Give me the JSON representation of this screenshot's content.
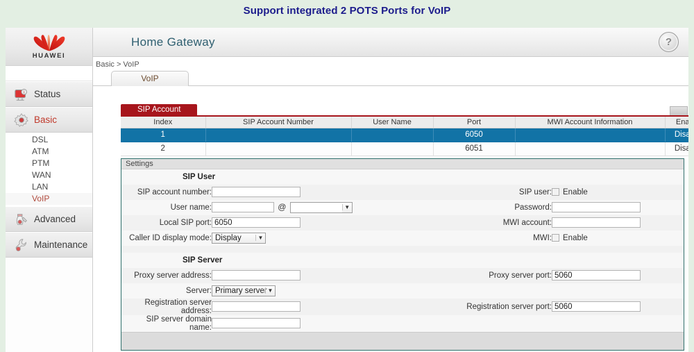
{
  "banner": {
    "title": "Support integrated 2 POTS Ports for VoIP",
    "color": "#1c1c8c"
  },
  "brand": {
    "name": "HUAWEI",
    "logo_icon": "huawei-flower-logo",
    "color": "#d8191f"
  },
  "sidebar": {
    "items": [
      {
        "label": "Status",
        "icon": "status-monitor-icon",
        "active": false
      },
      {
        "label": "Basic",
        "icon": "gear-icon",
        "active": true
      },
      {
        "label": "Advanced",
        "icon": "tools-icon",
        "active": false
      },
      {
        "label": "Maintenance",
        "icon": "wrench-icon",
        "active": false
      }
    ],
    "basic_subitems": [
      {
        "label": "DSL",
        "active": false
      },
      {
        "label": "ATM",
        "active": false
      },
      {
        "label": "PTM",
        "active": false
      },
      {
        "label": "WAN",
        "active": false
      },
      {
        "label": "LAN",
        "active": false
      },
      {
        "label": "VoIP",
        "active": true
      }
    ]
  },
  "header": {
    "app_title": "Home Gateway",
    "help_icon": "question-mark-icon",
    "help_label": "?",
    "breadcrumb": "Basic > VoIP",
    "tabs": [
      {
        "label": "VoIP",
        "active": true
      }
    ]
  },
  "account_panel": {
    "tab_label": "SIP Account",
    "tab_color": "#a7151c",
    "selected_row_color": "#1273a6",
    "columns": [
      "Index",
      "SIP Account Number",
      "User Name",
      "Port",
      "MWI Account Information",
      "Enable"
    ],
    "rows": [
      {
        "index": "1",
        "sip_account_number": "",
        "user_name": "",
        "port": "6050",
        "mwi_account_information": "",
        "enable": "Disable",
        "selected": true
      },
      {
        "index": "2",
        "sip_account_number": "",
        "user_name": "",
        "port": "6051",
        "mwi_account_information": "",
        "enable": "Disable",
        "selected": false
      }
    ]
  },
  "settings": {
    "title": "Settings",
    "sip_user": {
      "section_title": "SIP User",
      "sip_account_number": {
        "label": "SIP account number:",
        "value": ""
      },
      "user_name": {
        "label": "User name:",
        "value": "",
        "at": "@",
        "domain_value": ""
      },
      "local_sip_port": {
        "label": "Local SIP port:",
        "value": "6050"
      },
      "caller_id_display_mode": {
        "label": "Caller ID display mode:",
        "value": "Display"
      },
      "sip_user_enable": {
        "label": "SIP user:",
        "checkbox_label": "Enable",
        "checked": false
      },
      "password": {
        "label": "Password:",
        "value": ""
      },
      "mwi_account": {
        "label": "MWI account:",
        "value": ""
      },
      "mwi_enable": {
        "label": "MWI:",
        "checkbox_label": "Enable",
        "checked": false
      }
    },
    "sip_server": {
      "section_title": "SIP Server",
      "proxy_server_address": {
        "label": "Proxy server address:",
        "value": ""
      },
      "server": {
        "label": "Server:",
        "value": "Primary server"
      },
      "registration_server_address": {
        "label_line1": "Registration server",
        "label_line2": "address:",
        "value": ""
      },
      "sip_server_domain_name": {
        "label_line1": "SIP server domain",
        "label_line2": "name:",
        "value": ""
      },
      "proxy_server_port": {
        "label": "Proxy server port:",
        "value": "5060"
      },
      "registration_server_port": {
        "label": "Registration server port:",
        "value": "5060"
      }
    }
  }
}
